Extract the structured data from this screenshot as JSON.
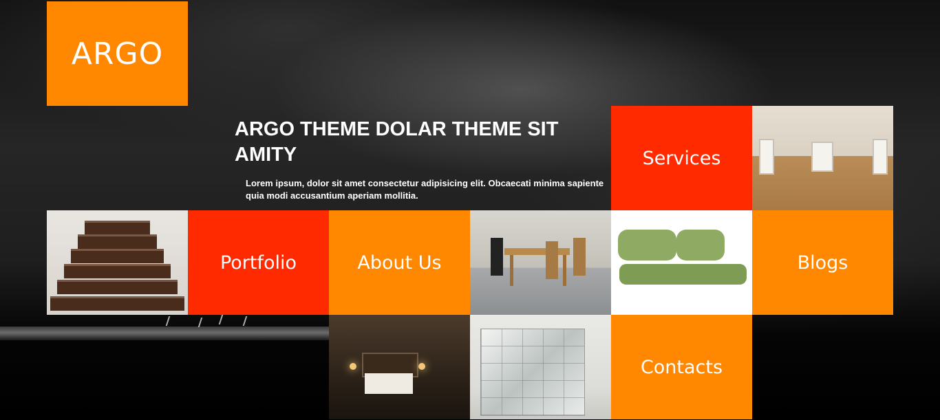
{
  "logo": {
    "text": "ARGO"
  },
  "hero": {
    "title": "ARGO THEME DOLAR THEME SIT AMITY",
    "subtitle": "Lorem ipsum, dolor sit amet consectetur adipisicing elit. Obcaecati minima sapiente quia modi accusantium aperiam mollitia."
  },
  "tiles": {
    "services": "Services",
    "portfolio": "Portfolio",
    "about": "About Us",
    "blogs": "Blogs",
    "contacts": "Contacts"
  },
  "colors": {
    "orange": "#ff8800",
    "red": "#ff2a00"
  }
}
